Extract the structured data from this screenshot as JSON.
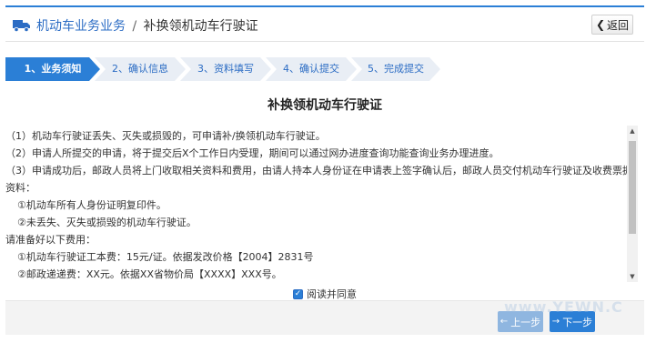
{
  "header": {
    "breadcrumb_link": "机动车业务业务",
    "separator": "/",
    "current": "补换领机动车行驶证",
    "back_label": "返回"
  },
  "steps": [
    {
      "label": "1、业务须知",
      "active": true
    },
    {
      "label": "2、确认信息",
      "active": false
    },
    {
      "label": "3、资料填写",
      "active": false
    },
    {
      "label": "4、确认提交",
      "active": false
    },
    {
      "label": "5、完成提交",
      "active": false
    }
  ],
  "title": "补换领机动车行驶证",
  "content": {
    "lines": [
      "（1）机动车行驶证丢失、灭失或损毁的，可申请补/换领机动车行驶证。",
      "（2）申请人所提交的申请，将于提交后X个工作日内受理，期间可以通过网办进度查询功能查询业务办理进度。",
      "（3）申请成功后，邮政人员将上门收取相关资料和费用，由请人持本人身份证在申请表上签字确认后，邮政人员交付机动车行驶证及收费票据，请提前准备好以下",
      "资料：",
      "①机动车所有人身份证明复印件。",
      "②未丢失、灭失或损毁的机动车行驶证。",
      "请准备好以下费用：",
      "①机动车行驶证工本费：15元/证。依据发改价格【2004】2831号",
      "②邮政递递费：XX元。依据XX省物价局【XXXX】XXX号。"
    ]
  },
  "agree_label": "阅读并同意",
  "footer": {
    "prev_label": "上一步",
    "next_label": "下一步"
  },
  "watermark": "www.YEWN.C",
  "colors": {
    "accent": "#2b7fd6",
    "step_active": "#2b7fd6",
    "step_inactive": "#e9eef5"
  }
}
